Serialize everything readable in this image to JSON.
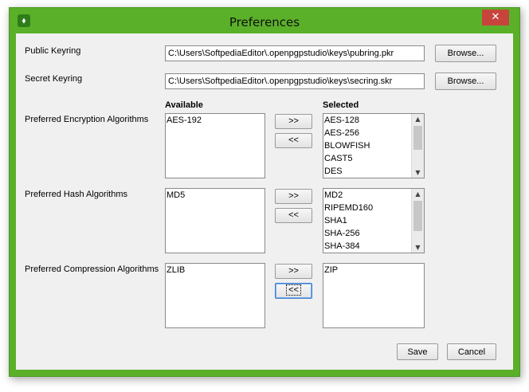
{
  "window": {
    "title": "Preferences",
    "close_glyph": "✕",
    "app_icon_glyph": "⬧"
  },
  "keyrings": {
    "public_label": "Public Keyring",
    "public_path": "C:\\Users\\SoftpediaEditor\\.openpgpstudio\\keys\\pubring.pkr",
    "secret_label": "Secret Keyring",
    "secret_path": "C:\\Users\\SoftpediaEditor\\.openpgpstudio\\keys\\secring.skr",
    "browse_label": "Browse..."
  },
  "headers": {
    "available": "Available",
    "selected": "Selected"
  },
  "encryption": {
    "label": "Preferred Encryption Algorithms",
    "available": [
      "AES-192"
    ],
    "selected": [
      "AES-128",
      "AES-256",
      "BLOWFISH",
      "CAST5",
      "DES"
    ]
  },
  "hash": {
    "label": "Preferred Hash Algorithms",
    "available": [
      "MD5"
    ],
    "selected": [
      "MD2",
      "RIPEMD160",
      "SHA1",
      "SHA-256",
      "SHA-384"
    ]
  },
  "compression": {
    "label": "Preferred Compression Algorithms",
    "available": [
      "ZLIB"
    ],
    "selected": [
      "ZIP"
    ]
  },
  "transfer": {
    "add_label": ">>",
    "remove_label": "<<"
  },
  "footer": {
    "save_label": "Save",
    "cancel_label": "Cancel"
  },
  "colors": {
    "title_bar": "#5bb02a",
    "close_button": "#c7443d",
    "client_bg": "#f0f0f0"
  },
  "icons": {
    "app": "openpgp-studio-icon",
    "close": "close-icon",
    "scroll_up": "scroll-up-icon",
    "scroll_down": "scroll-down-icon"
  }
}
